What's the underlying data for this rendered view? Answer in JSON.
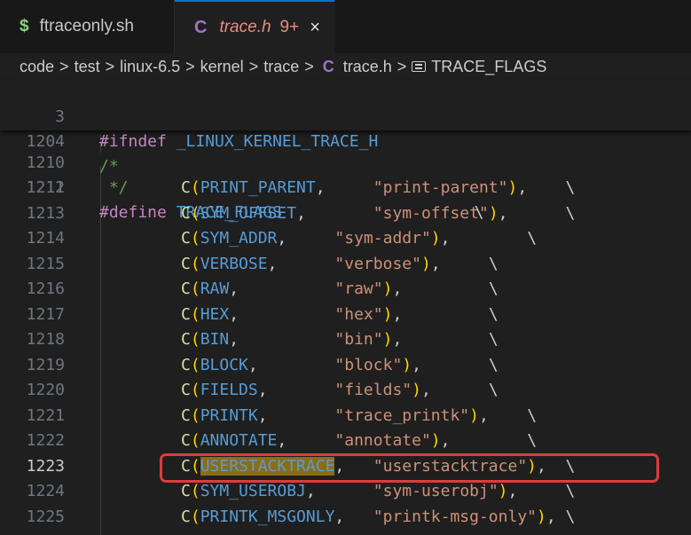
{
  "tabs": [
    {
      "icon": "$",
      "label": "ftraceonly.sh",
      "active": false
    },
    {
      "icon": "C",
      "label": "trace.h",
      "badge": "9+",
      "close": "×",
      "active": true
    }
  ],
  "breadcrumb": {
    "items": [
      "code",
      "test",
      "linux-6.5",
      "kernel",
      "trace"
    ],
    "file_icon": "C",
    "file": "trace.h",
    "symbol": "TRACE_FLAGS",
    "separator": ">"
  },
  "sticky_lines": [
    {
      "number": "3",
      "directive": "#ifndef",
      "name": "_LINUX_KERNEL_TRACE_H"
    },
    {
      "number": "1204",
      "comment": "/*"
    }
  ],
  "lines": [
    {
      "number": "1210",
      "comment": " */"
    },
    {
      "number": "1211",
      "directive": "#define",
      "name": "TRACE_FLAGS",
      "cont": "\\"
    },
    {
      "number": "1212",
      "fn": "C",
      "flag": "PRINT_PARENT",
      "pad1": "     ",
      "str": "\"print-parent\"",
      "pad2": "    ",
      "cont": "\\"
    },
    {
      "number": "1213",
      "fn": "C",
      "flag": "SYM_OFFSET",
      "pad1": "       ",
      "str": "\"sym-offset\"",
      "pad2": "      ",
      "cont": "\\"
    },
    {
      "number": "1214",
      "fn": "C",
      "flag": "SYM_ADDR",
      "pad1": "     ",
      "str": "\"sym-addr\"",
      "pad2": "        ",
      "cont": "\\"
    },
    {
      "number": "1215",
      "fn": "C",
      "flag": "VERBOSE",
      "pad1": "      ",
      "str": "\"verbose\"",
      "pad2": "     ",
      "cont": "\\"
    },
    {
      "number": "1216",
      "fn": "C",
      "flag": "RAW",
      "pad1": "          ",
      "str": "\"raw\"",
      "pad2": "         ",
      "cont": "\\"
    },
    {
      "number": "1217",
      "fn": "C",
      "flag": "HEX",
      "pad1": "          ",
      "str": "\"hex\"",
      "pad2": "         ",
      "cont": "\\"
    },
    {
      "number": "1218",
      "fn": "C",
      "flag": "BIN",
      "pad1": "          ",
      "str": "\"bin\"",
      "pad2": "         ",
      "cont": "\\"
    },
    {
      "number": "1219",
      "fn": "C",
      "flag": "BLOCK",
      "pad1": "        ",
      "str": "\"block\"",
      "pad2": "       ",
      "cont": "\\"
    },
    {
      "number": "1220",
      "fn": "C",
      "flag": "FIELDS",
      "pad1": "       ",
      "str": "\"fields\"",
      "pad2": "      ",
      "cont": "\\"
    },
    {
      "number": "1221",
      "fn": "C",
      "flag": "PRINTK",
      "pad1": "       ",
      "str": "\"trace_printk\"",
      "pad2": "    ",
      "cont": "\\"
    },
    {
      "number": "1222",
      "fn": "C",
      "flag": "ANNOTATE",
      "pad1": "     ",
      "str": "\"annotate\"",
      "pad2": "        ",
      "cont": "\\"
    },
    {
      "number": "1223",
      "fn": "C",
      "flag": "USERSTACKTRACE",
      "pad1": "   ",
      "str": "\"userstacktrace\"",
      "pad2": "  ",
      "cont": "\\",
      "current": true,
      "highlight": true
    },
    {
      "number": "1224",
      "fn": "C",
      "flag": "SYM_USEROBJ",
      "pad1": "      ",
      "str": "\"sym-userobj\"",
      "pad2": "     ",
      "cont": "\\"
    },
    {
      "number": "1225",
      "fn": "C",
      "flag": "PRINTK_MSGONLY",
      "pad1": "   ",
      "str": "\"printk-msg-only\"",
      "pad2": " ",
      "cont": "\\"
    }
  ],
  "colors": {
    "background": "#1f1f1f",
    "highlight": "#8a6d14",
    "annotation_box": "#e03c3c",
    "string": "#ce9178",
    "macro": "#569cd6",
    "directive": "#c586c0"
  }
}
